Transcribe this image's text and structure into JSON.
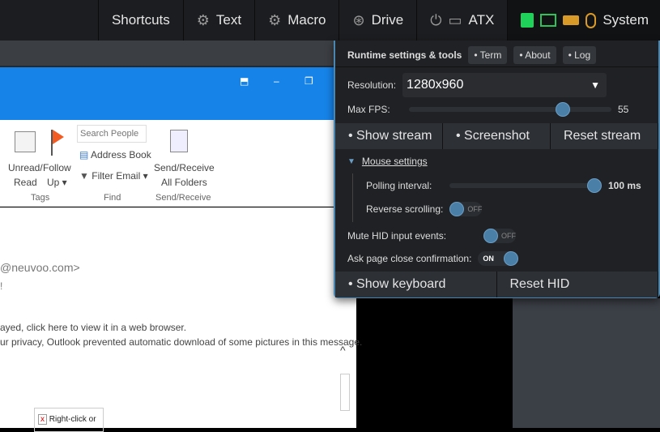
{
  "topbar": {
    "items": [
      {
        "label": "Shortcuts",
        "icon": ""
      },
      {
        "label": "Text",
        "icon": "gear-icon"
      },
      {
        "label": "Macro",
        "icon": "gear-icon"
      },
      {
        "label": "Drive",
        "icon": "drive-icon"
      },
      {
        "label": "ATX",
        "icon": "power-icon"
      },
      {
        "label": "System",
        "icon": "mouse-icon"
      }
    ],
    "status_colors": {
      "network": "#1fd35a",
      "display": "#2cc35a",
      "keyboard": "#d99a28",
      "mouse": "#d99a28"
    }
  },
  "outlook": {
    "ribbon": {
      "unread": "Unread/",
      "read": "Read",
      "follow": "Follow",
      "up": "Up ▾",
      "tags": "Tags",
      "search_placeholder": "Search People",
      "address_book": "Address Book",
      "filter_email": "Filter Email ▾",
      "find": "Find",
      "send_receive_1": "Send/Receive",
      "send_receive_2": "All Folders",
      "send_receive_group": "Send/Receive"
    },
    "body": {
      "from": "@neuvoo.com>",
      "excl": "!",
      "line1": "ayed, click here to view it in a web browser.",
      "line2": "ur privacy, Outlook prevented automatic download of some pictures in this message.",
      "img_alt": "Right-click or"
    }
  },
  "panel": {
    "title": "Runtime settings & tools",
    "chips": [
      "• Term",
      "• About",
      "• Log"
    ],
    "resolution_label": "Resolution:",
    "resolution_value": "1280x960",
    "fps_label": "Max FPS:",
    "fps_value": "55",
    "fps_fraction": 0.78,
    "stream_buttons": [
      "• Show stream",
      "• Screenshot",
      "Reset stream"
    ],
    "mouse_settings": "Mouse settings",
    "polling_label": "Polling interval:",
    "polling_value": "100 ms",
    "polling_fraction": 1.0,
    "reverse_label": "Reverse scrolling:",
    "reverse_state": "OFF",
    "mute_label": "Mute HID input events:",
    "mute_state": "OFF",
    "confirm_label": "Ask page close confirmation:",
    "confirm_state": "ON",
    "hid_buttons": [
      "• Show keyboard",
      "Reset HID"
    ]
  }
}
